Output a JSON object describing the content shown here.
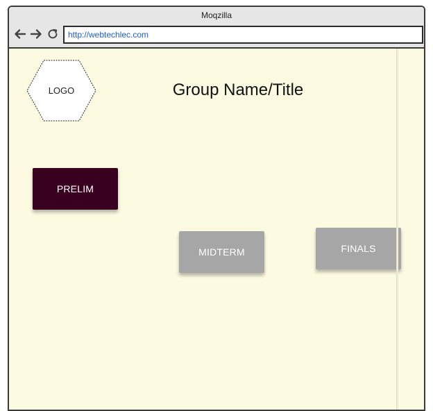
{
  "window": {
    "title": "Moqzilla"
  },
  "toolbar": {
    "address": "http://webtechlec.com",
    "back_icon": "arrow-left-icon",
    "forward_icon": "arrow-right-icon",
    "reload_icon": "reload-icon"
  },
  "header": {
    "logo_text": "LOGO",
    "title": "Group Name/Title"
  },
  "buttons": {
    "prelim": "PRELIM",
    "midterm": "MIDTERM",
    "finals": "FINALS"
  },
  "colors": {
    "page_background": "#fdfae2",
    "active_button": "#3a0020",
    "inactive_button": "#a6a6a6",
    "link_text": "#1c5bd6"
  }
}
